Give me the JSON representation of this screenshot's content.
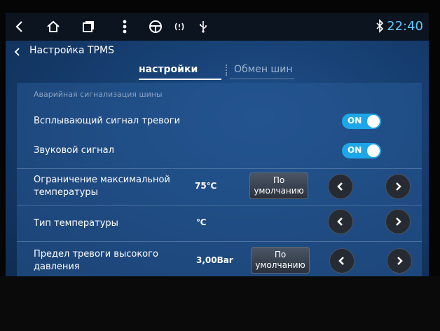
{
  "statusbar": {
    "icons": [
      "back-icon",
      "home-icon",
      "recent-apps-icon",
      "menu-icon",
      "steering-wheel-icon",
      "tpms-icon",
      "usb-icon"
    ],
    "bluetooth_icon": "bluetooth-icon",
    "time": "22:40",
    "time_color": "#5fc9ff"
  },
  "titlebar": {
    "title": "Настройка TPMS"
  },
  "tabs": {
    "active": "настройки",
    "inactive": "Обмен шин"
  },
  "panel": {
    "section_header": "Аварийная сигнализация шины",
    "rows": [
      {
        "label": "Всплывающий сигнал тревоги",
        "toggle": "ON"
      },
      {
        "label": "Звуковой сигнал",
        "toggle": "ON"
      },
      {
        "label_line1": "Ограничение максимальной",
        "label_line2": "температуры",
        "value": "75℃",
        "default_line1": "По",
        "default_line2": "умолчанию"
      },
      {
        "label": "Тип температуры",
        "value": "℃"
      },
      {
        "label_line1": "Предел тревоги высокого",
        "label_line2": "давления",
        "value": "3,00Bar",
        "default_line1": "По",
        "default_line2": "умолчанию"
      }
    ]
  },
  "colors": {
    "accent": "#1da7e8",
    "panel_bg": "#2a5a96"
  }
}
